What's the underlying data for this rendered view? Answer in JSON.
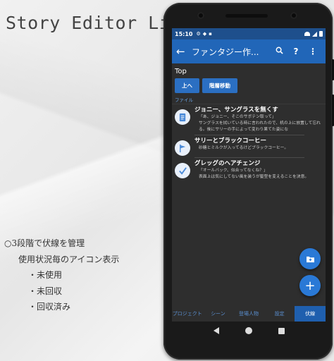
{
  "promo": {
    "app_title": "Story Editor Lite",
    "feature_head": "○3段階で伏線を管理",
    "feature_sub": "使用状況毎のアイコン表示",
    "states": [
      "・未使用",
      "・未回収",
      "・回収済み"
    ]
  },
  "status": {
    "time": "15:10",
    "icons": [
      "settings-icon",
      "shield-icon",
      "sd-card-icon"
    ]
  },
  "appbar": {
    "back_glyph": "←",
    "title": "ファンタジー作...",
    "search_glyph": "🔍",
    "help_glyph": "?",
    "more_glyph": "⋮"
  },
  "path": "Top",
  "buttons": {
    "up": "上へ",
    "move": "階層移動"
  },
  "section_label": "ファイル",
  "items": [
    {
      "title": "ジョニー、サングラスを無くす",
      "desc": "「あ、ジョニー、そこのサボテン取って」\nサングラスを拭いている時に言われたので、机の上に放置して忘れる。後にサリーの手によって変わり果てた姿にな",
      "icon": "document-icon"
    },
    {
      "title": "サリーとブラックコーヒー",
      "desc": "砂糖とミルクが入ってるけどブラックコーヒー。",
      "icon": "flag-icon"
    },
    {
      "title": "グレッグのヘアチェンジ",
      "desc": "「オールバック、似合ってなくね？」\n表面上は気にしてない風を装うが髪型を変えることを決意。",
      "icon": "check-icon"
    }
  ],
  "fab": {
    "new_folder_glyph": "+",
    "add_glyph": "+"
  },
  "tabs": [
    "プロジェクト",
    "シーン",
    "登場人物",
    "設定",
    "伏線"
  ],
  "colors": {
    "accent": "#2166b8",
    "status": "#1e4f8c",
    "fab": "#2a79d6",
    "background": "#2e2e2e"
  }
}
